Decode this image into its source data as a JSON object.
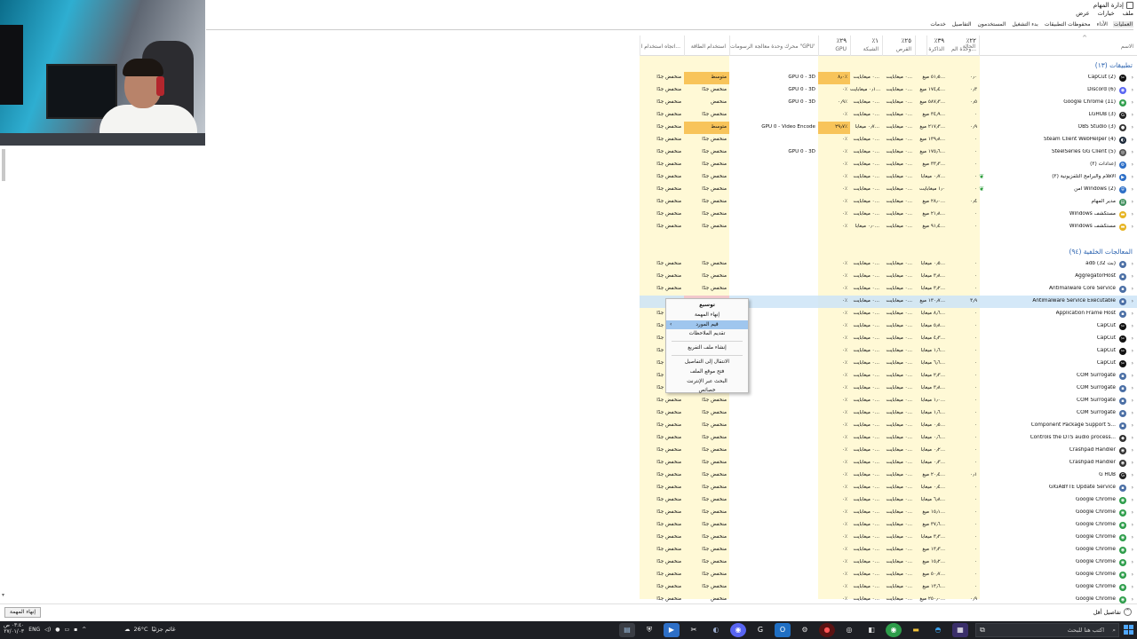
{
  "window": {
    "title": "إدارة المهام"
  },
  "menu": [
    "ملف",
    "خيارات",
    "عرض"
  ],
  "tabs": [
    "العمليات",
    "الأداء",
    "محفوظات التطبيقات",
    "بدء التشغيل",
    "المستخدمون",
    "التفاصيل",
    "خدمات"
  ],
  "columns": {
    "name": {
      "pct": "",
      "label": "الاسم"
    },
    "status": {
      "pct": "",
      "label": "الحالة"
    },
    "cpu": {
      "pct": "٪٢٢",
      "label": "وحدة الم..."
    },
    "memory": {
      "pct": "٪٣٩",
      "label": "الذاكرة"
    },
    "disk": {
      "pct": "٪٢٥",
      "label": "القرص"
    },
    "network": {
      "pct": "٪١",
      "label": "الشبكة"
    },
    "gpu": {
      "pct": "٪٢٩",
      "label": "GPU"
    },
    "gpu_engine": {
      "pct": "",
      "label": "محرك وحدة معالجة الرسومات \"GPU\""
    },
    "power": {
      "pct": "",
      "label": "استخدام الطاقة"
    },
    "power_trend": {
      "pct": "",
      "label": "اتجاه استخدام ا..."
    }
  },
  "groups": {
    "apps": "تطبيقات (١٣)",
    "background": "المعالجات الخلفية (٩٤)"
  },
  "app_rows": [
    {
      "name": "CapCut (2)",
      "icon": "capcut-icon",
      "ic": "✂",
      "icbg": "#111",
      "cpu": "٠٫٠",
      "mem": "٥١٫٥ ميغ...",
      "disk": "٠ ميغابايت...",
      "net": "٠ ميغابايت...",
      "gpu": "٨٫٠٪",
      "engine": "GPU 0 - 3D",
      "power": "متوسط",
      "trend": "منخفض جدًا",
      "hlpow": true,
      "hlgpu": true
    },
    {
      "name": "Discord (6)",
      "icon": "discord-icon",
      "ic": "◉",
      "icbg": "#5865f2",
      "cpu": "٠٫٣",
      "mem": "١٧٤٫٤ ميغ...",
      "disk": "٠ ميغابايت...",
      "net": "٠٫١ ميغابايت...",
      "gpu": "٠٪",
      "engine": "GPU 0 - 3D",
      "power": "منخفض جدًا",
      "trend": "منخفض جدًا",
      "hlpow": false,
      "hlgpu": false
    },
    {
      "name": "Google Chrome (11)",
      "icon": "chrome-icon",
      "ic": "◉",
      "icbg": "#2d9d4a",
      "cpu": "٠٫٥",
      "mem": "٥٨٧٫٣ ميغ...",
      "disk": "٠ ميغابايت...",
      "net": "٠ ميغابايت...",
      "gpu": "٠٫٩٪",
      "engine": "GPU 0 - 3D",
      "power": "منخفض",
      "trend": "منخفض جدًا",
      "hlpow": false,
      "hlgpu": false
    },
    {
      "name": "LGHUB (3)",
      "icon": "lghub-icon",
      "ic": "G",
      "icbg": "#222",
      "cpu": "٠",
      "mem": "٣٤٫٩ ميغ...",
      "disk": "٠ ميغابايت...",
      "net": "٠ ميغابايت...",
      "gpu": "٠٪",
      "engine": "",
      "power": "منخفض جدًا",
      "trend": "منخفض جدًا",
      "hlpow": false,
      "hlgpu": false
    },
    {
      "name": "OBS Studio (3)",
      "icon": "obs-icon",
      "ic": "●",
      "icbg": "#333",
      "cpu": "٠٫٩",
      "mem": "٢١٧٫٣ ميغ...",
      "disk": "٠ ميغابايت...",
      "net": "٠٫٧ ميغابا...",
      "gpu": "٢٩٫٧٪",
      "engine": "GPU 0 - Video Encode",
      "power": "متوسط",
      "trend": "منخفض جدًا",
      "hlpow": true,
      "hlgpu": true
    },
    {
      "name": "Steam Client WebHelper (4)",
      "icon": "steam-icon",
      "ic": "◐",
      "icbg": "#1b2838",
      "cpu": "٠",
      "mem": "١٣٩٫٨ ميغ...",
      "disk": "٠ ميغابايت...",
      "net": "٠ ميغابايت...",
      "gpu": "٠٪",
      "engine": "",
      "power": "منخفض جدًا",
      "trend": "منخفض جدًا",
      "hlpow": false,
      "hlgpu": false
    },
    {
      "name": "SteelSeries GG Client (5)",
      "icon": "steelseries-icon",
      "ic": "◎",
      "icbg": "#555",
      "cpu": "٠",
      "mem": "١٧٥٫٦ ميغ...",
      "disk": "٠ ميغابايت...",
      "net": "٠ ميغابايت...",
      "gpu": "٠٪",
      "engine": "GPU 0 - 3D",
      "power": "منخفض جدًا",
      "trend": "منخفض جدًا",
      "hlpow": false,
      "hlgpu": false
    },
    {
      "name": "إعدادات (٢)",
      "icon": "settings-icon",
      "ic": "⚙",
      "icbg": "#2d6fc7",
      "cpu": "٠",
      "mem": "٣٣٫٣ ميغ...",
      "disk": "٠ ميغابايت...",
      "net": "٠ ميغابايت...",
      "gpu": "٠٪",
      "engine": "",
      "power": "منخفض جدًا",
      "trend": "منخفض جدًا",
      "hlpow": false,
      "hlgpu": false,
      "leaf": false
    },
    {
      "name": "الأفلام والبرامج التلفزيونية (٢)",
      "icon": "movies-icon",
      "ic": "▶",
      "icbg": "#2d6fc7",
      "cpu": "٠",
      "mem": "٠٫٧ ميغابا...",
      "disk": "٠ ميغابايت...",
      "net": "٠ ميغابايت...",
      "gpu": "٠٪",
      "engine": "",
      "power": "منخفض جدًا",
      "trend": "منخفض جدًا",
      "hlpow": false,
      "hlgpu": false,
      "leaf": true
    },
    {
      "name": "أمن Windows (2)",
      "icon": "windows-security-icon",
      "ic": "⛨",
      "icbg": "#2d6fc7",
      "cpu": "٠",
      "mem": "١٫٠ ميغابايت",
      "disk": "٠ ميغابايت...",
      "net": "٠ ميغابايت...",
      "gpu": "٠٪",
      "engine": "",
      "power": "منخفض جدًا",
      "trend": "منخفض جدًا",
      "hlpow": false,
      "hlgpu": false,
      "leaf": true
    },
    {
      "name": "مدير المهام",
      "icon": "task-manager-icon",
      "ic": "▤",
      "icbg": "#3c8d5a",
      "cpu": "٠٫٤",
      "mem": "٢٨٫٠ ميغ...",
      "disk": "٠ ميغابايت...",
      "net": "٠ ميغابايت...",
      "gpu": "٠٪",
      "engine": "",
      "power": "منخفض جدًا",
      "trend": "منخفض جدًا",
      "hlpow": false,
      "hlgpu": false
    },
    {
      "name": "Windows مستكشف",
      "icon": "explorer-icon",
      "ic": "▬",
      "icbg": "#e6b422",
      "cpu": "٠",
      "mem": "٢١٫٨ ميغ...",
      "disk": "٠ ميغابايت...",
      "net": "٠ ميغابايت...",
      "gpu": "٠٪",
      "engine": "",
      "power": "منخفض جدًا",
      "trend": "منخفض جدًا",
      "hlpow": false,
      "hlgpu": false
    },
    {
      "name": "Windows مستكشف",
      "icon": "explorer-icon",
      "ic": "▬",
      "icbg": "#e6b422",
      "cpu": "٠",
      "mem": "٩١٫٤ ميغ...",
      "disk": "٠ ميغابايت...",
      "net": "٠٫٠ ميغابا...",
      "gpu": "٠٪",
      "engine": "",
      "power": "منخفض جدًا",
      "trend": "منخفض جدًا",
      "hlpow": false,
      "hlgpu": false
    }
  ],
  "bg_rows": [
    {
      "name": "adb (32 بت)",
      "icon": "process-icon",
      "ic": "▪",
      "icbg": "#4b6fa5",
      "cpu": "٠",
      "mem": "٠٫٥ ميغابا...",
      "power": "منخفض جدًا",
      "trend": "منخفض جدًا"
    },
    {
      "name": "AggregatorHost",
      "icon": "process-icon",
      "ic": "▪",
      "icbg": "#4b6fa5",
      "cpu": "٠",
      "mem": "٣٫٨ ميغابا...",
      "power": "منخفض جدًا",
      "trend": "منخفض جدًا"
    },
    {
      "name": "Antimalware Core Service",
      "icon": "process-icon",
      "ic": "▪",
      "icbg": "#4b6fa5",
      "cpu": "٠",
      "mem": "٣٫٢ ميغابا...",
      "power": "منخفض جدًا",
      "trend": "منخفض جدًا"
    },
    {
      "name": "Antimalware Service Executable",
      "icon": "process-icon",
      "ic": "▪",
      "icbg": "#4b6fa5",
      "cpu": "٣٫٩",
      "mem": "١٣٠٫٧ ميغ...",
      "power": "عالي جدًا",
      "trend": "منخفض",
      "sel": true
    },
    {
      "name": "Application Frame Host",
      "icon": "process-icon",
      "ic": "▪",
      "icbg": "#4b6fa5",
      "cpu": "٠",
      "mem": "٨٫٦ ميغابا...",
      "power": "منخفض جدًا",
      "trend": "منخفض جدًا"
    },
    {
      "name": "CapCut",
      "icon": "capcut-icon",
      "ic": "✂",
      "icbg": "#111",
      "cpu": "٠",
      "mem": "٥٫٨ ميغابا...",
      "power": "منخفض جدًا",
      "trend": "منخفض جدًا"
    },
    {
      "name": "CapCut",
      "icon": "capcut-icon",
      "ic": "✂",
      "icbg": "#111",
      "cpu": "٠",
      "mem": "٤٫٣ ميغابا...",
      "power": "منخفض جدًا",
      "trend": "منخفض جدًا"
    },
    {
      "name": "CapCut",
      "icon": "capcut-icon",
      "ic": "✂",
      "icbg": "#111",
      "cpu": "٠",
      "mem": "١٫٦ ميغابا...",
      "power": "منخفض جدًا",
      "trend": "منخفض جدًا"
    },
    {
      "name": "CapCut",
      "icon": "capcut-icon",
      "ic": "✂",
      "icbg": "#111",
      "cpu": "٠",
      "mem": "٦٫٦ ميغابا...",
      "power": "منخفض جدًا",
      "trend": "منخفض جدًا"
    },
    {
      "name": "COM Surrogate",
      "icon": "process-icon",
      "ic": "▪",
      "icbg": "#4b6fa5",
      "cpu": "٠",
      "mem": "٢٫٣ ميغابا...",
      "power": "منخفض جدًا",
      "trend": "منخفض جدًا"
    },
    {
      "name": "COM Surrogate",
      "icon": "process-icon",
      "ic": "▪",
      "icbg": "#4b6fa5",
      "cpu": "٠",
      "mem": "٣٫٨ ميغابا...",
      "power": "منخفض جدًا",
      "trend": "منخفض جدًا"
    },
    {
      "name": "COM Surrogate",
      "icon": "process-icon",
      "ic": "▪",
      "icbg": "#4b6fa5",
      "cpu": "٠",
      "mem": "١٫٠ ميغابا...",
      "power": "منخفض جدًا",
      "trend": "منخفض جدًا"
    },
    {
      "name": "COM Surrogate",
      "icon": "process-icon",
      "ic": "▪",
      "icbg": "#4b6fa5",
      "cpu": "٠",
      "mem": "١٫٦ ميغابا...",
      "power": "منخفض جدًا",
      "trend": "منخفض جدًا"
    },
    {
      "name": "Component Package Support S...",
      "icon": "process-icon",
      "ic": "▪",
      "icbg": "#4b6fa5",
      "cpu": "٠",
      "mem": "٠٫٥ ميغابا...",
      "power": "منخفض جدًا",
      "trend": "منخفض جدًا"
    },
    {
      "name": "Controls the DTS audio process...",
      "icon": "dts-icon",
      "ic": "◆",
      "icbg": "#333",
      "cpu": "٠",
      "mem": "٠٫٦ ميغابا...",
      "power": "منخفض جدًا",
      "trend": "منخفض جدًا"
    },
    {
      "name": "Crashpad Handler",
      "icon": "process-icon",
      "ic": "◉",
      "icbg": "#333",
      "cpu": "٠",
      "mem": "٠٫٢ ميغابا...",
      "power": "منخفض جدًا",
      "trend": "منخفض جدًا"
    },
    {
      "name": "Crashpad Handler",
      "icon": "process-icon",
      "ic": "◉",
      "icbg": "#333",
      "cpu": "٠",
      "mem": "٠٫٣ ميغابا...",
      "power": "منخفض جدًا",
      "trend": "منخفض جدًا"
    },
    {
      "name": "G HUB",
      "icon": "lghub-icon",
      "ic": "G",
      "icbg": "#222",
      "cpu": "٠٫١",
      "mem": "٢٠٫٤ ميغ...",
      "power": "منخفض جدًا",
      "trend": "منخفض جدًا"
    },
    {
      "name": "GIGABYTE Update Service",
      "icon": "process-icon",
      "ic": "▪",
      "icbg": "#4b6fa5",
      "cpu": "٠",
      "mem": "٠٫٤ ميغابا...",
      "power": "منخفض جدًا",
      "trend": "منخفض جدًا"
    },
    {
      "name": "Google Chrome",
      "icon": "chrome-icon",
      "ic": "◉",
      "icbg": "#2d9d4a",
      "cpu": "٠",
      "mem": "٦٫٨ ميغابا...",
      "power": "منخفض جدًا",
      "trend": "منخفض جدًا"
    },
    {
      "name": "Google Chrome",
      "icon": "chrome-icon",
      "ic": "◉",
      "icbg": "#2d9d4a",
      "cpu": "٠",
      "mem": "١٥٫١ ميغ...",
      "power": "منخفض جدًا",
      "trend": "منخفض جدًا"
    },
    {
      "name": "Google Chrome",
      "icon": "chrome-icon",
      "ic": "◉",
      "icbg": "#2d9d4a",
      "cpu": "٠",
      "mem": "٣٧٫٦ ميغ...",
      "power": "منخفض جدًا",
      "trend": "منخفض جدًا"
    },
    {
      "name": "Google Chrome",
      "icon": "chrome-icon",
      "ic": "◉",
      "icbg": "#2d9d4a",
      "cpu": "٠",
      "mem": "٣٫٣ ميغابا...",
      "power": "منخفض جدًا",
      "trend": "منخفض جدًا"
    },
    {
      "name": "Google Chrome",
      "icon": "chrome-icon",
      "ic": "◉",
      "icbg": "#2d9d4a",
      "cpu": "٠",
      "mem": "١٣٫٣ ميغ...",
      "power": "منخفض جدًا",
      "trend": "منخفض جدًا"
    },
    {
      "name": "Google Chrome",
      "icon": "chrome-icon",
      "ic": "◉",
      "icbg": "#2d9d4a",
      "cpu": "٠",
      "mem": "١٥٫٢ ميغ...",
      "power": "منخفض جدًا",
      "trend": "منخفض جدًا"
    },
    {
      "name": "Google Chrome",
      "icon": "chrome-icon",
      "ic": "◉",
      "icbg": "#2d9d4a",
      "cpu": "٠",
      "mem": "٥٠٫٧ ميغ...",
      "power": "منخفض جدًا",
      "trend": "منخفض جدًا"
    },
    {
      "name": "Google Chrome",
      "icon": "chrome-icon",
      "ic": "◉",
      "icbg": "#2d9d4a",
      "cpu": "٠",
      "mem": "١٣٫٦ ميغ...",
      "power": "منخفض جدًا",
      "trend": "منخفض جدًا"
    },
    {
      "name": "Google Chrome",
      "icon": "chrome-icon",
      "ic": "◉",
      "icbg": "#2d9d4a",
      "cpu": "٠٫٩",
      "mem": "٢٥٠٫٠ ميغ...",
      "power": "منخفض",
      "trend": "منخفض جدًا"
    }
  ],
  "bg_common": {
    "disk": "٠ ميغابايت...",
    "net": "٠ ميغابايت...",
    "gpu": "٠٪"
  },
  "context_menu": {
    "items": [
      "توسيع",
      "إنهاء المهمة",
      "قيم المورد",
      "تقديم الملاحظات",
      "إنشاء ملف التفريغ",
      "الانتقال إلى التفاصيل",
      "فتح موقع الملف",
      "البحث عبر الإنترنت",
      "خصائص"
    ],
    "highlighted_index": 2
  },
  "status_bar": {
    "end_task": "إنهاء المهمة",
    "fewer_details": "تفاصيل أقل"
  },
  "taskbar": {
    "search_placeholder": "اكتب هنا للبحث",
    "weather_temp": "26°C",
    "weather_text": "غائم جزئيًا",
    "lang": "ENG",
    "time": "٠٣:٤٠ ص",
    "date": "٢٧/٠١/٠٣"
  },
  "colors": {
    "yellow": "#fff9d6",
    "orange": "#f8c45a",
    "pink": "#f2c9cc",
    "selected": "#cce4f7",
    "accent": "#2b63b0"
  }
}
